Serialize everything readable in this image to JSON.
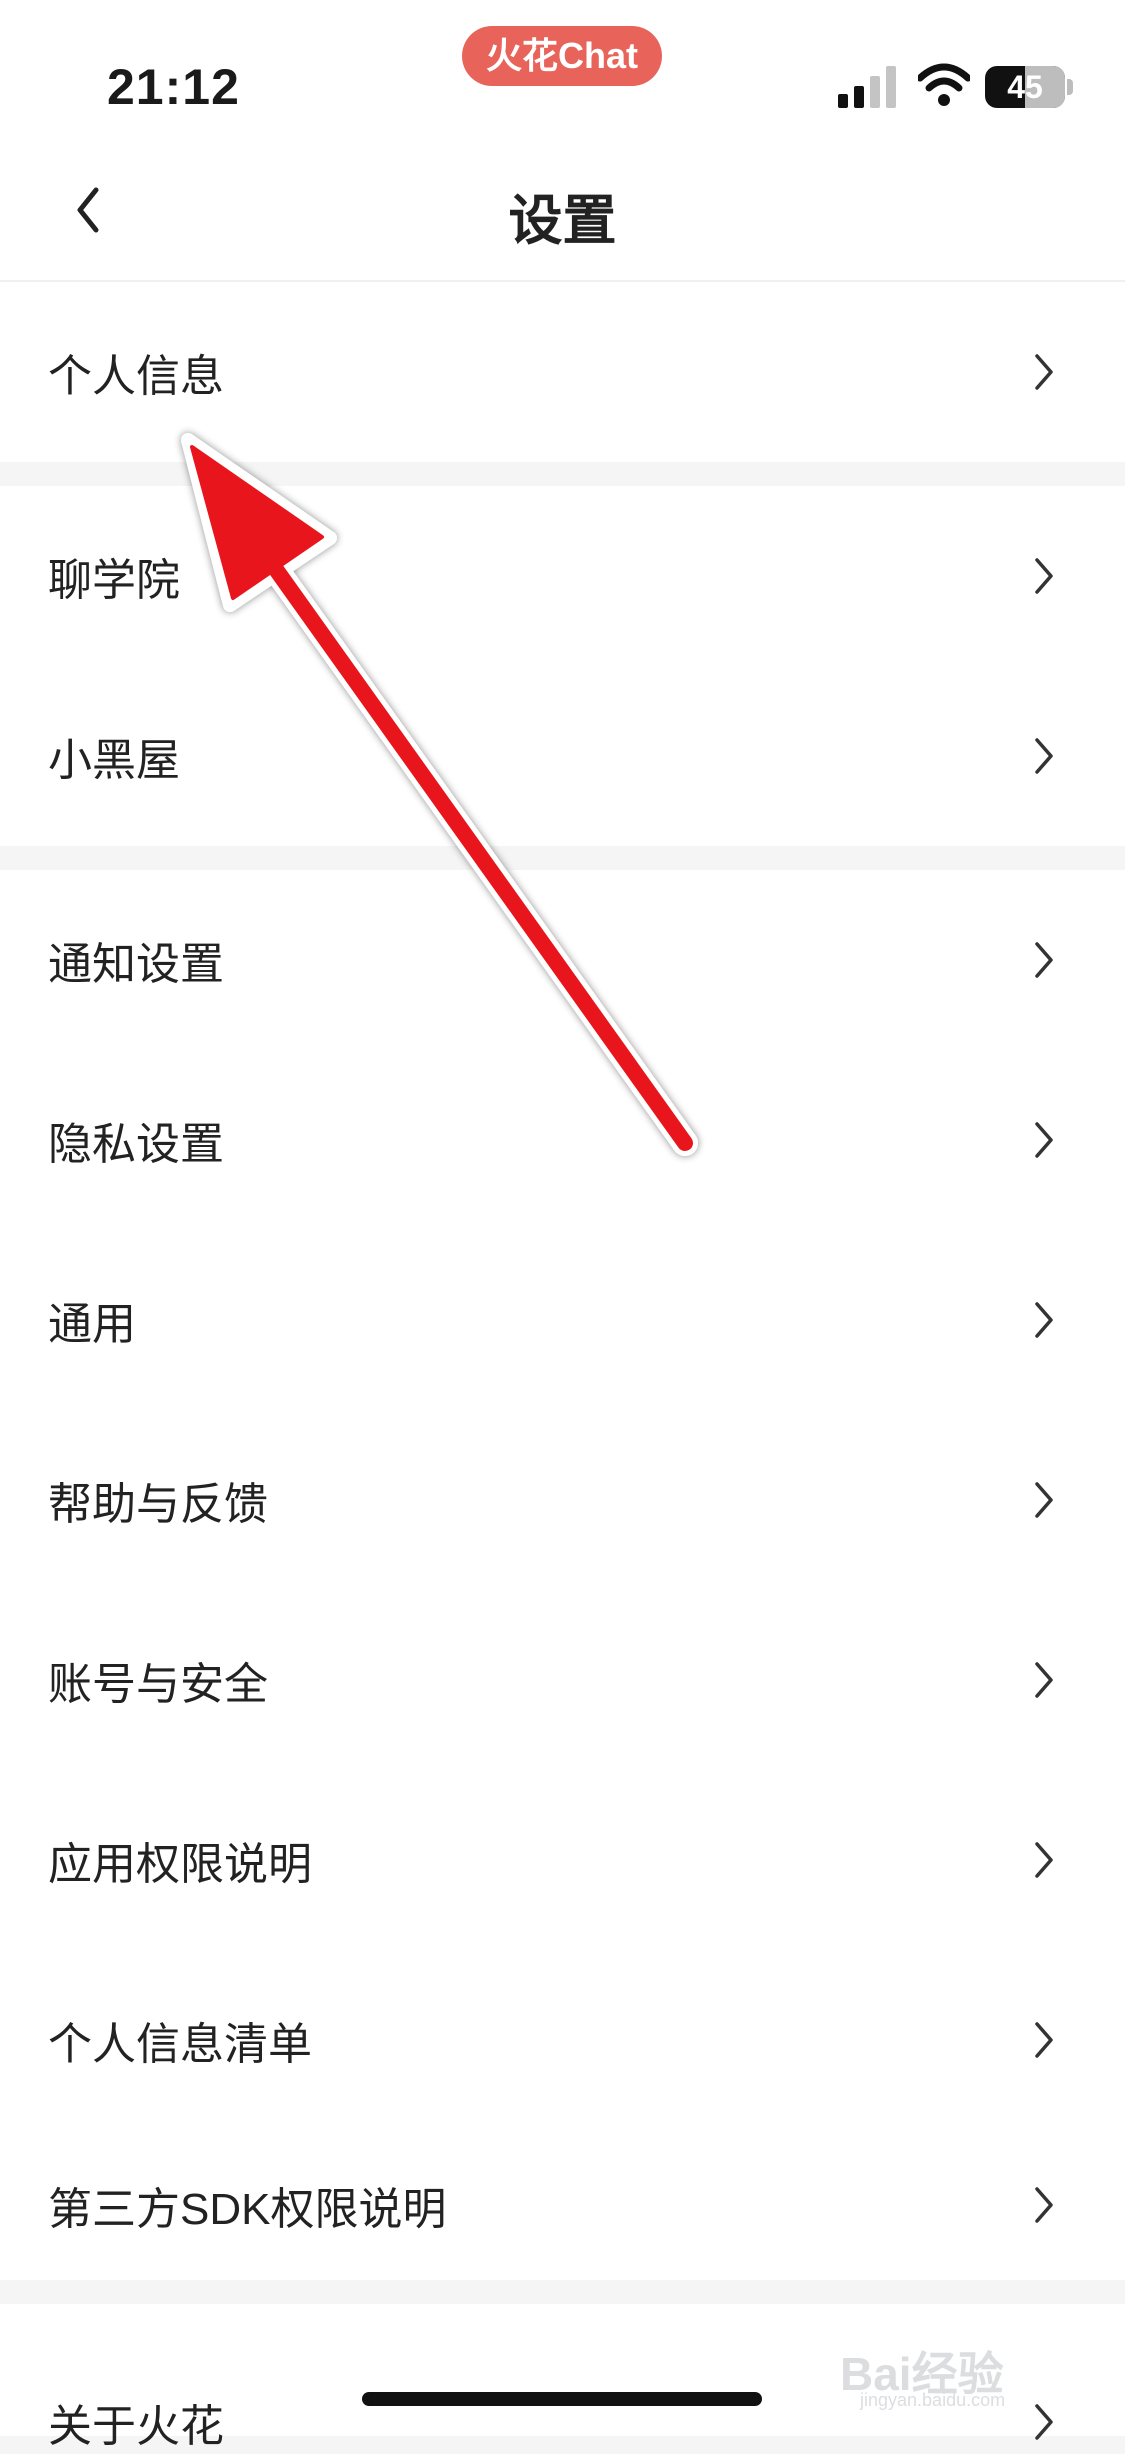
{
  "status_bar": {
    "time": "21:12",
    "app_pill": "火花Chat",
    "battery": "45",
    "icons": [
      "signal-icon",
      "wifi-icon",
      "battery-icon"
    ]
  },
  "nav": {
    "title": "设置",
    "back_icon": "chevron-left-icon"
  },
  "groups": [
    {
      "items": [
        "个人信息"
      ]
    },
    {
      "items": [
        "聊学院",
        "小黑屋"
      ]
    },
    {
      "items": [
        "通知设置",
        "隐私设置",
        "通用",
        "帮助与反馈",
        "账号与安全",
        "应用权限说明",
        "个人信息清单",
        "第三方SDK权限说明"
      ]
    },
    {
      "items": [
        "关于火花"
      ]
    }
  ],
  "row_icon": "chevron-right-icon",
  "watermark": {
    "text": "Bai经验",
    "sub": "jingyan.baidu.com"
  },
  "annotation": {
    "type": "red-arrow-icon",
    "color": "#e8141c",
    "points_to": "个人信息"
  },
  "colors": {
    "accent": "#e8645a",
    "background": "#f5f5f5",
    "row": "#ffffff"
  }
}
